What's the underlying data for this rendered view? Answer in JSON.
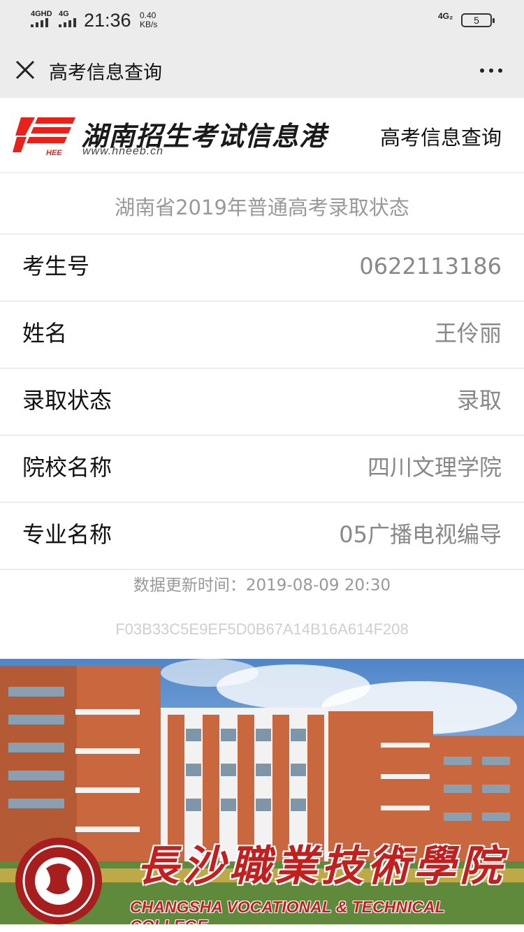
{
  "status_bar": {
    "network1": "4GHD",
    "network2": "4G",
    "time": "21:36",
    "speed_value": "0.40",
    "speed_unit": "KB/s",
    "network_right": "4G₂",
    "battery": "5"
  },
  "nav": {
    "title": "高考信息查询",
    "close_icon": "close-icon",
    "more_icon": "more-icon"
  },
  "header": {
    "site_title": "湖南招生考试信息港",
    "site_url": "www.hneeb.cn",
    "logo_text": "HEE",
    "link_label": "高考信息查询",
    "brand_color": "#e8211b"
  },
  "result": {
    "title": "湖南省2019年普通高考录取状态",
    "rows": [
      {
        "label": "考生号",
        "value": "0622113186"
      },
      {
        "label": "姓名",
        "value": "王伶丽"
      },
      {
        "label": "录取状态",
        "value": "录取"
      },
      {
        "label": "院校名称",
        "value": "四川文理学院"
      },
      {
        "label": "专业名称",
        "value": "05广播电视编导"
      }
    ],
    "update_label": "数据更新时间：",
    "update_time": "2019-08-09 20:30",
    "hash": "F03B33C5E9EF5D0B67A14B16A614F208"
  },
  "banner": {
    "school_name": "長沙職業技術學院",
    "school_name_en": "CHANGSHA VOCATIONAL & TECHNICAL COLLEGE",
    "accent_color": "#c21f1f"
  }
}
